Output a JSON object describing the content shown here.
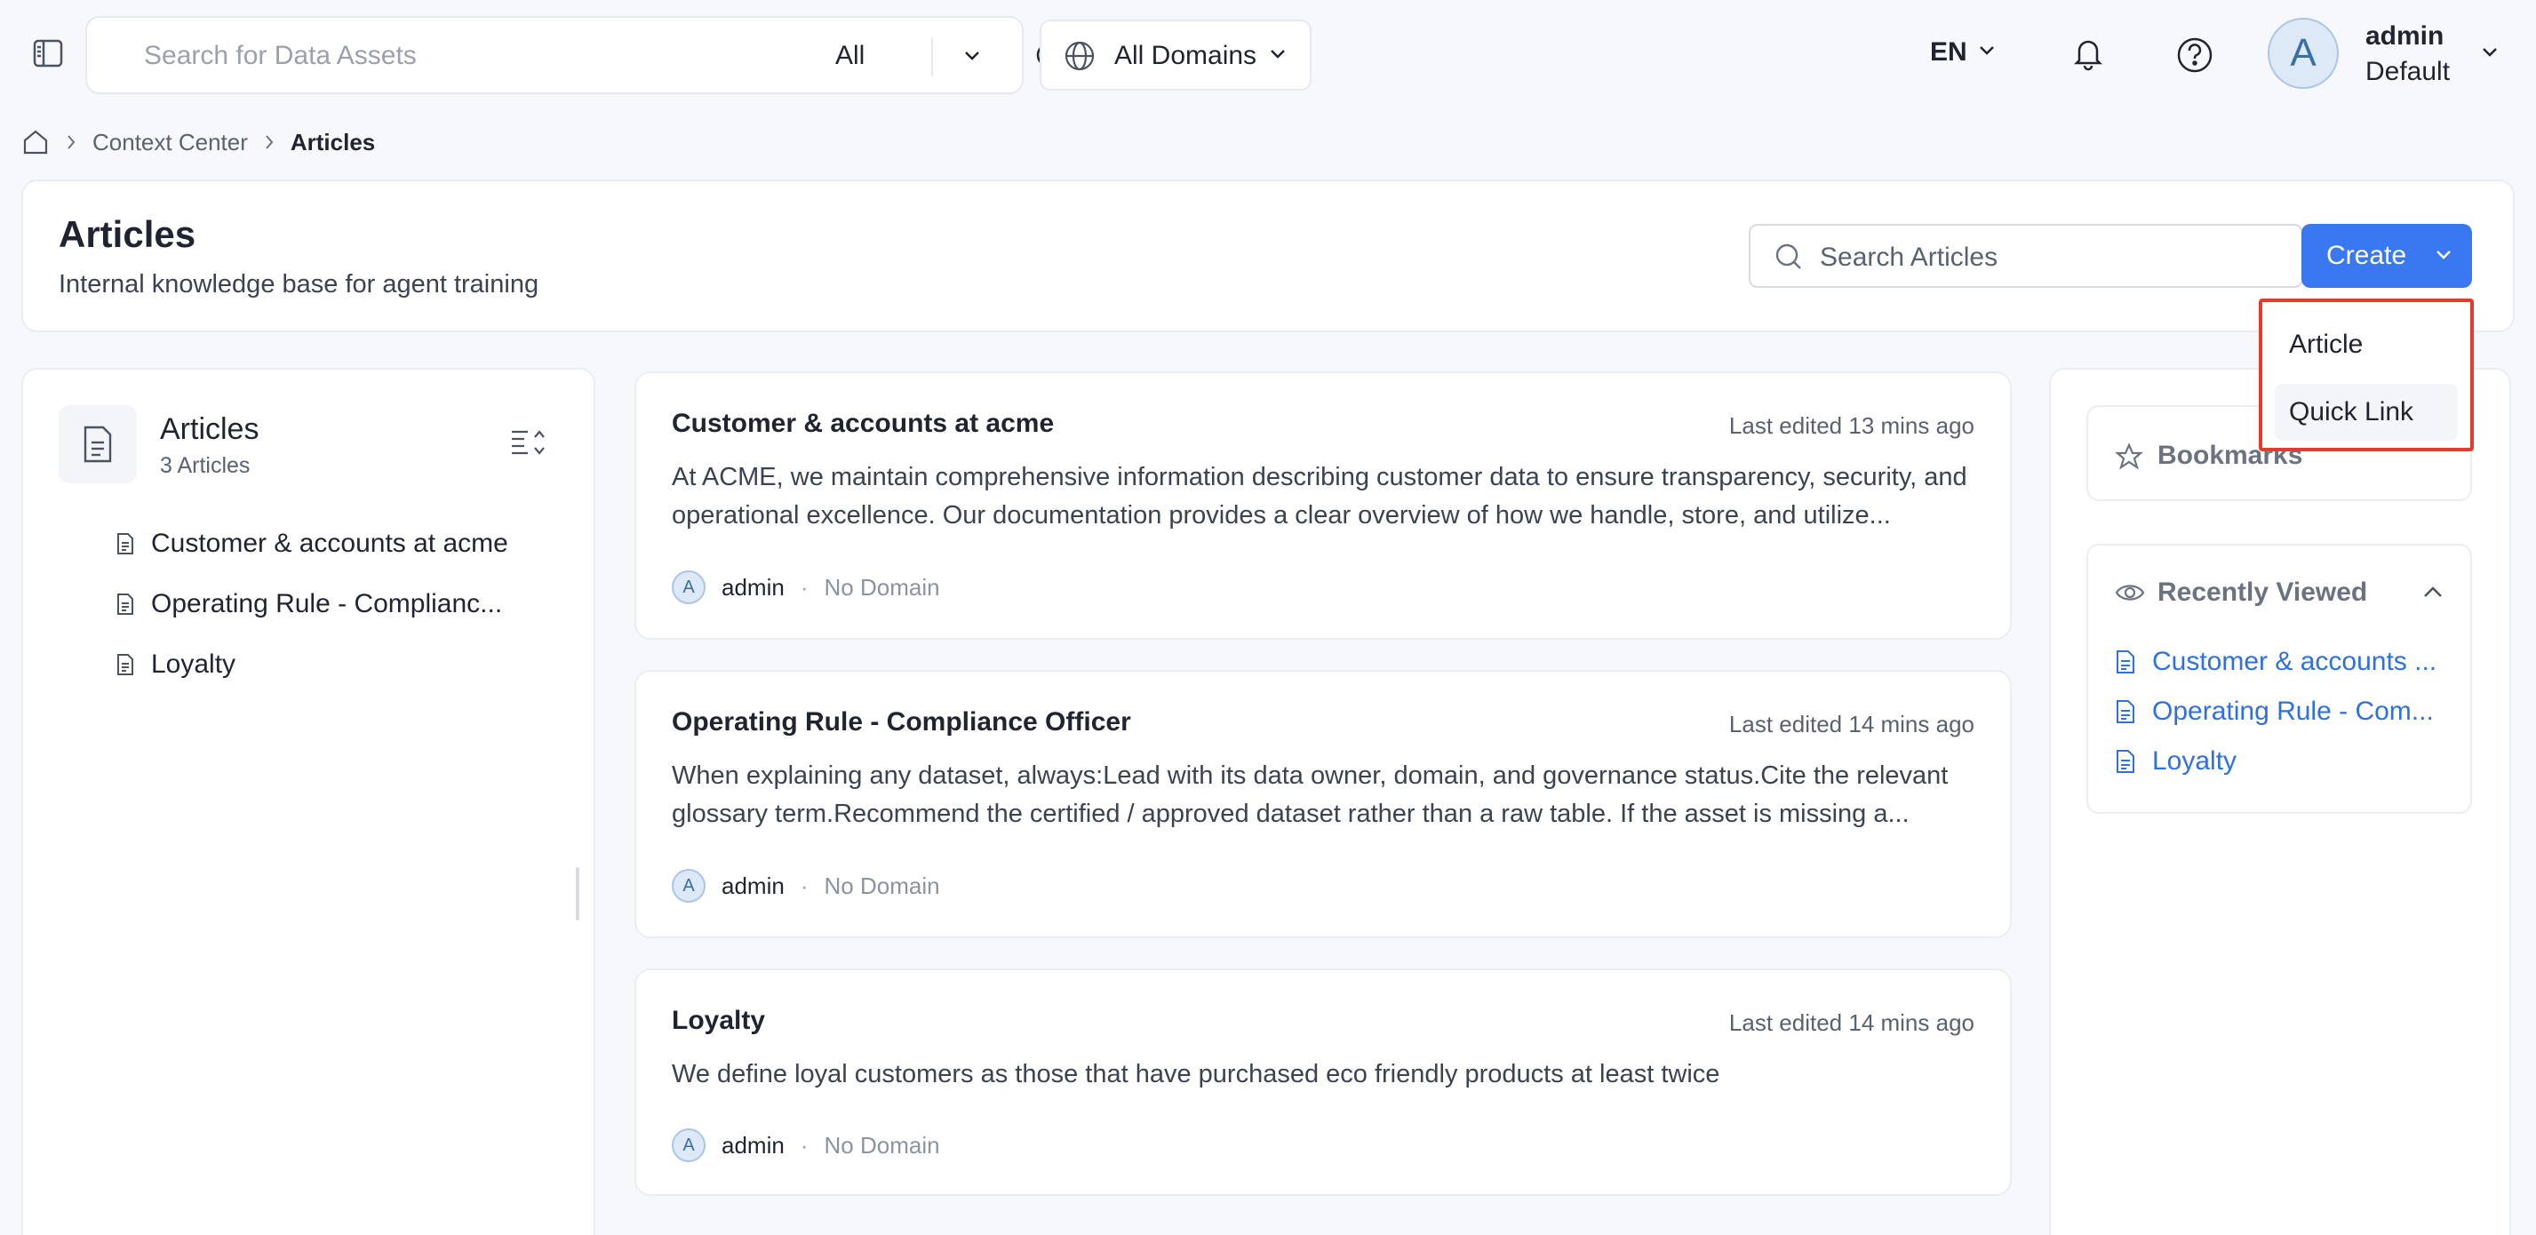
{
  "topbar": {
    "search_placeholder": "Search for Data Assets",
    "search_scope": "All",
    "domains_label": "All Domains",
    "language": "EN",
    "user": {
      "avatar_letter": "A",
      "name": "admin",
      "role": "Default"
    }
  },
  "breadcrumb": {
    "items": [
      "Context Center",
      "Articles"
    ]
  },
  "header": {
    "title": "Articles",
    "subtitle": "Internal knowledge base for agent training",
    "search_placeholder": "Search Articles",
    "create_label": "Create"
  },
  "create_menu": {
    "items": [
      "Article",
      "Quick Link"
    ]
  },
  "left_panel": {
    "title": "Articles",
    "count": "3 Articles",
    "items": [
      "Customer & accounts at acme",
      "Operating Rule - Complianc...",
      "Loyalty"
    ]
  },
  "articles": [
    {
      "title": "Customer & accounts at acme",
      "edited": "Last edited 13 mins ago",
      "body": "At ACME, we maintain comprehensive information describing customer data to ensure transparency, security, and operational excellence. Our documentation provides a clear overview of how we handle, store, and utilize...",
      "author_initial": "A",
      "author": "admin",
      "dot": "·",
      "domain": "No Domain"
    },
    {
      "title": "Operating Rule - Compliance Officer",
      "edited": "Last edited 14 mins ago",
      "body": "When explaining any dataset, always:Lead with its data owner, domain, and governance status.Cite the relevant glossary term.Recommend the certified / approved dataset rather than a raw table. If the asset is missing a...",
      "author_initial": "A",
      "author": "admin",
      "dot": "·",
      "domain": "No Domain"
    },
    {
      "title": "Loyalty",
      "edited": "Last edited 14 mins ago",
      "body": "We define loyal customers as those that have purchased eco friendly products at least twice",
      "author_initial": "A",
      "author": "admin",
      "dot": "·",
      "domain": "No Domain"
    }
  ],
  "right_panel": {
    "bookmarks_label": "Bookmarks",
    "recent_label": "Recently Viewed",
    "recent_items": [
      "Customer & accounts ...",
      "Operating Rule - Com...",
      "Loyalty"
    ]
  },
  "colors": {
    "accent": "#3a78f2",
    "link": "#2f6fe0",
    "highlight_border": "#e53a2f"
  }
}
